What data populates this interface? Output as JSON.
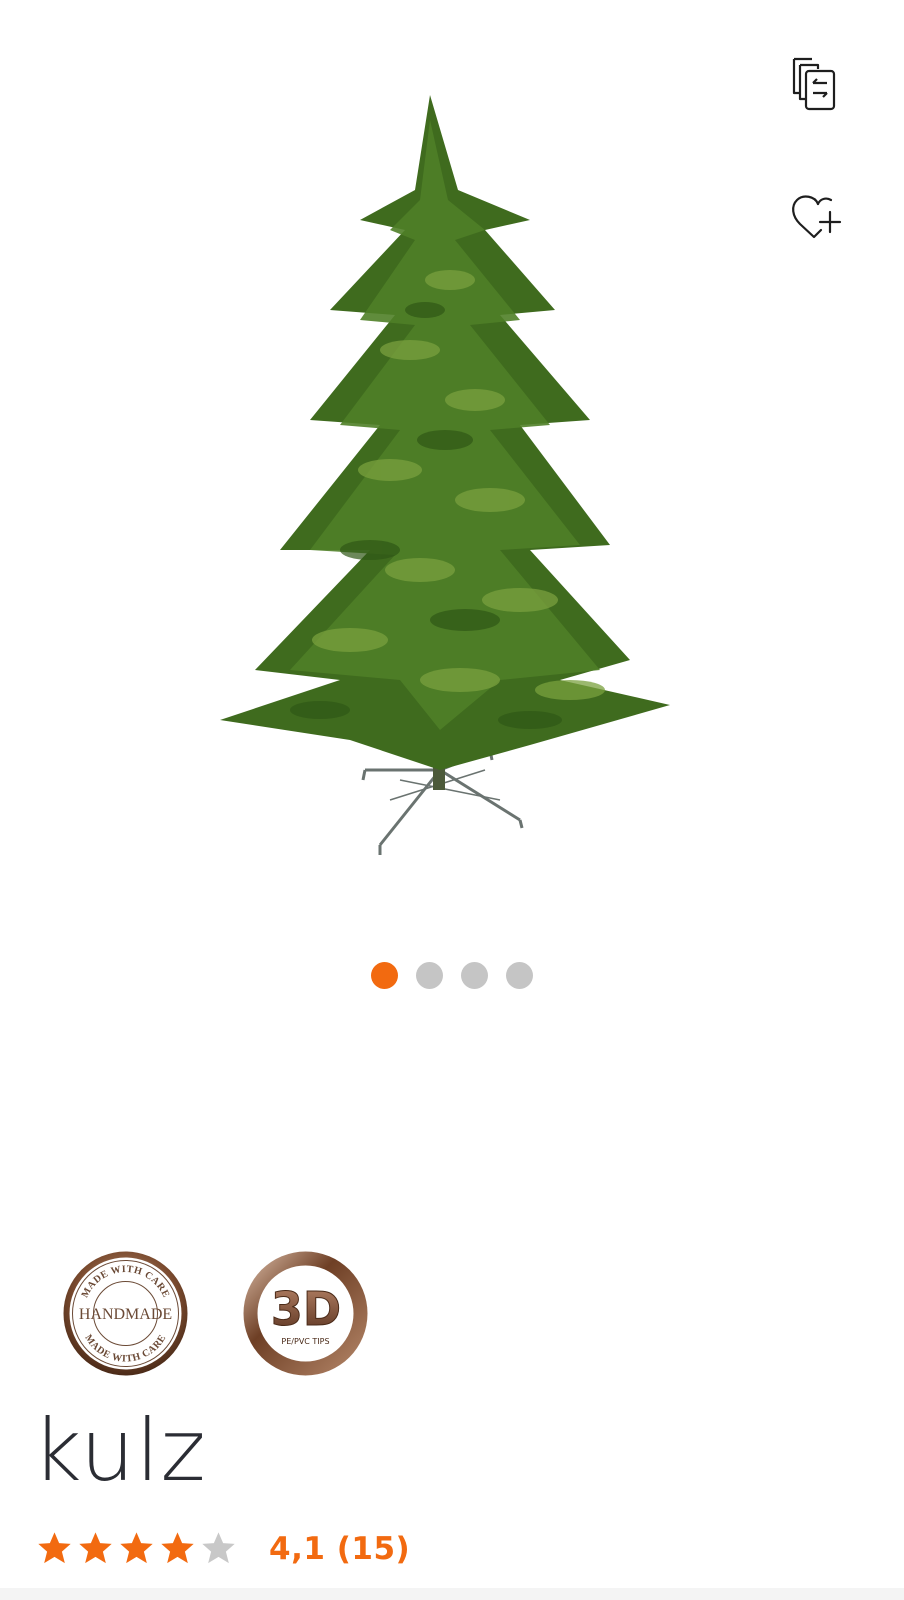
{
  "gallery": {
    "image": "christmas-tree-product-photo",
    "active_slide": 1,
    "slide_count": 4
  },
  "actions": {
    "compare_icon": "compare-icon",
    "wishlist_icon": "heart-plus-icon"
  },
  "badges": [
    {
      "icon": "handmade-badge",
      "lines": [
        "MADE WITH CARE",
        "HANDMADE",
        "MADE WITH CARE"
      ]
    },
    {
      "icon": "3d-tips-badge",
      "lines": [
        "3D",
        "PE/PVC TIPS"
      ]
    }
  ],
  "product": {
    "brand": "kulz",
    "rating_value": 4.1,
    "rating_label": "4,1 (15)",
    "review_count": 15
  },
  "colors": {
    "accent": "#f26a10",
    "dot_inactive": "#c5c5c5",
    "star_empty": "#c8c8c8",
    "badge_bronze": "#7a4a2e"
  }
}
